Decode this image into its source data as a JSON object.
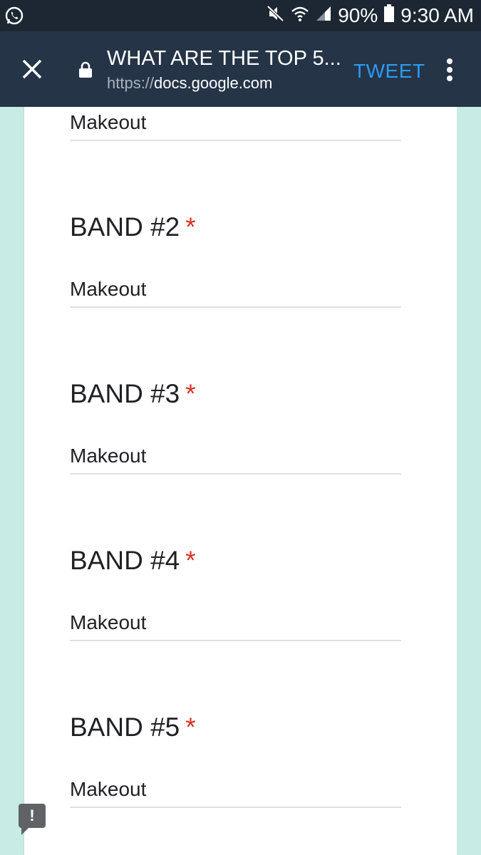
{
  "status_bar": {
    "battery": "90%",
    "time": "9:30 AM"
  },
  "header": {
    "title": "WHAT ARE THE TOP 5...",
    "url_protocol": "https://",
    "url_domain": "docs.google.com",
    "tweet_label": "TWEET"
  },
  "form": {
    "first_answer": "Makeout",
    "questions": [
      {
        "label": "BAND #2",
        "required": "*",
        "answer": "Makeout"
      },
      {
        "label": "BAND #3",
        "required": "*",
        "answer": "Makeout"
      },
      {
        "label": "BAND #4",
        "required": "*",
        "answer": "Makeout"
      },
      {
        "label": "BAND #5",
        "required": "*",
        "answer": "Makeout"
      }
    ]
  },
  "colors": {
    "accent": "#2b9bf0",
    "required": "#d93025",
    "background": "#c8ebe6"
  }
}
